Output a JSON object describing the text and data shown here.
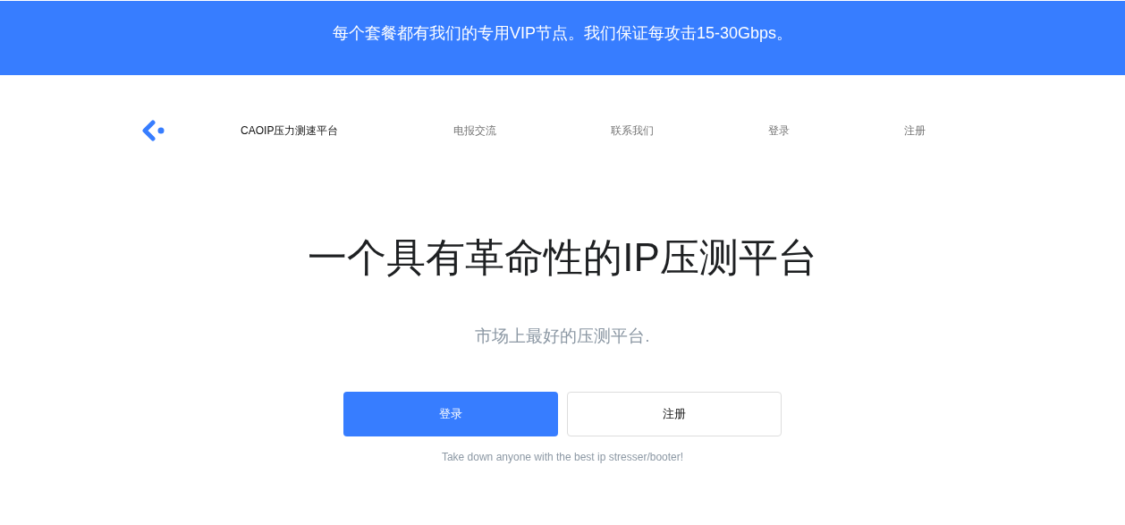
{
  "banner": {
    "text": "每个套餐都有我们的专用VIP节点。我们保证每攻击15-30Gbps。"
  },
  "nav": {
    "items": [
      {
        "label": "CAOIP压力测速平台",
        "selected": true
      },
      {
        "label": "电报交流",
        "selected": false
      },
      {
        "label": "联系我们",
        "selected": false
      },
      {
        "label": "登录",
        "selected": false
      },
      {
        "label": "注册",
        "selected": false
      }
    ]
  },
  "hero": {
    "title": "一个具有革命性的IP压测平台",
    "subtitle": "市场上最好的压测平台.",
    "buttons": [
      {
        "label": "登录",
        "kind": "primary"
      },
      {
        "label": "注册",
        "kind": "outline"
      }
    ],
    "caption": "Take down anyone with the best ip stresser/booter!"
  }
}
